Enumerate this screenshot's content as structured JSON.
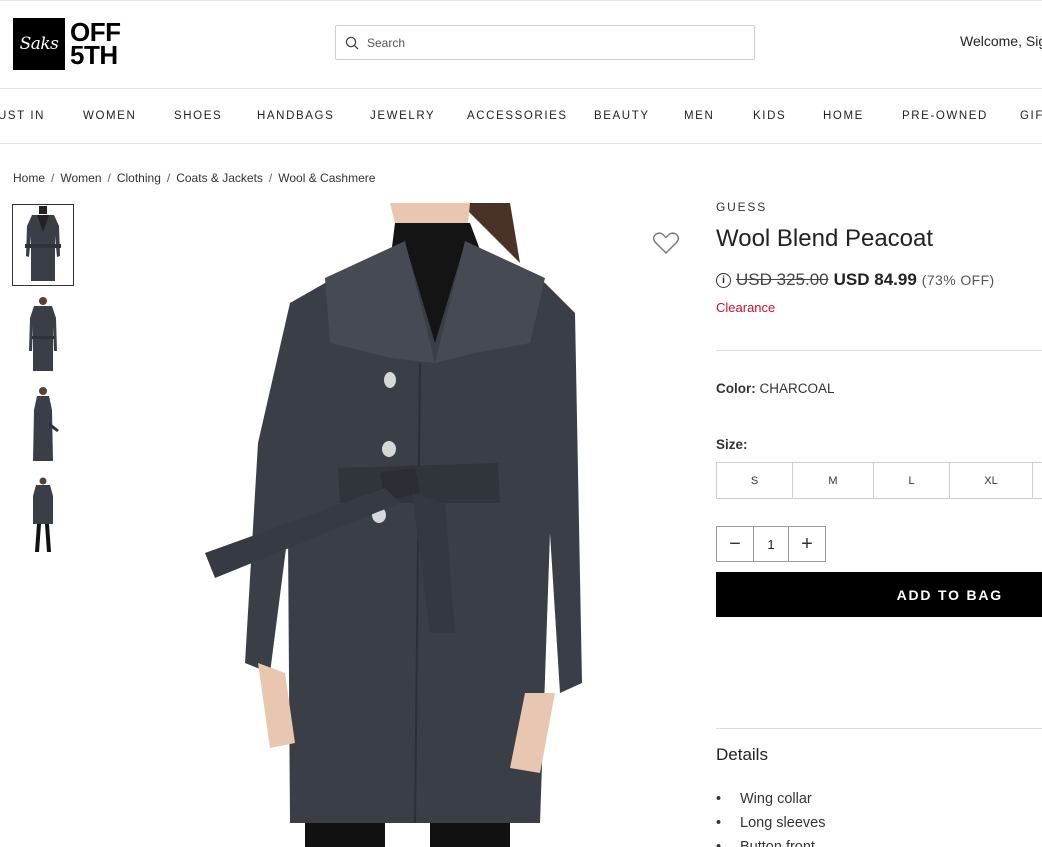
{
  "header": {
    "logo_script": "Saks",
    "logo_line1": "OFF",
    "logo_line2": "5TH",
    "search_placeholder": "Search",
    "welcome": "Welcome, Sig"
  },
  "nav": {
    "items": [
      "UST IN",
      "WOMEN",
      "SHOES",
      "HANDBAGS",
      "JEWELRY",
      "ACCESSORIES",
      "BEAUTY",
      "MEN",
      "KIDS",
      "HOME",
      "PRE-OWNED",
      "GIF"
    ]
  },
  "breadcrumb": [
    "Home",
    "Women",
    "Clothing",
    "Coats & Jackets",
    "Wool & Cashmere"
  ],
  "breadcrumb_separator": "/",
  "product": {
    "brand": "GUESS",
    "title": "Wool Blend Peacoat",
    "info_symbol": "i",
    "original_price": "USD 325.00",
    "sale_price": "USD 84.99",
    "discount": "(73% OFF)",
    "clearance": "Clearance",
    "color_label": "Color:",
    "color_value": "CHARCOAL",
    "size_label": "Size:",
    "sizes": [
      "S",
      "M",
      "L",
      "XL",
      ""
    ],
    "quantity": "1",
    "qty_minus": "−",
    "qty_plus": "+",
    "add_to_bag": "ADD TO BAG",
    "details_title": "Details",
    "details": [
      "Wing collar",
      "Long sleeves",
      "Button front"
    ]
  },
  "colors": {
    "clearance": "#c8102e",
    "coat": "#3a3f47",
    "button_bg": "#000000"
  }
}
